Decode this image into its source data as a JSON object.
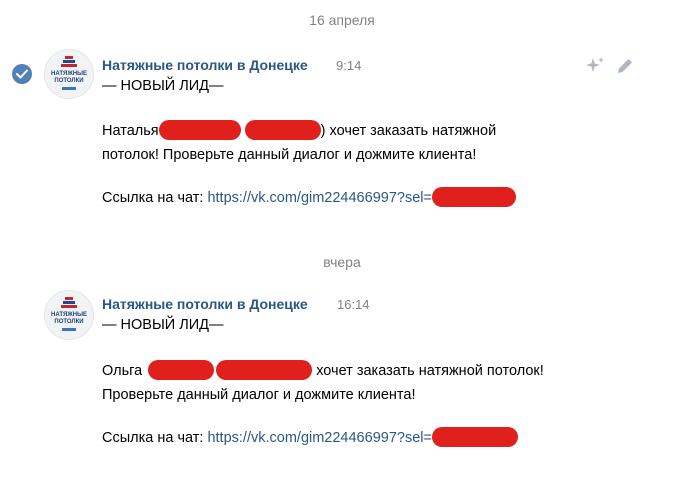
{
  "dates": {
    "first": "16 апреля",
    "second": "вчера"
  },
  "messages": [
    {
      "author": "Натяжные потолки в Донецке",
      "time": "9:14",
      "header": "— НОВЫЙ ЛИД—",
      "line1_name": "Наталья",
      "line1_close": ")",
      "line1_rest": " хочет заказать натяжной",
      "line2": "потолок! Проверьте данный диалог и дожмите клиента!",
      "link_label": "Ссылка на чат: ",
      "link_url": "https://vk.com/gim224466997?sel="
    },
    {
      "author": "Натяжные потолки в Донецке",
      "time": "16:14",
      "header": "— НОВЫЙ ЛИД—",
      "line1_name": "Ольга",
      "line1_close": "",
      "line1_rest": " хочет заказать натяжной потолок!",
      "line2": "Проверьте данный диалог и дожмите клиента!",
      "link_label": "Ссылка на чат: ",
      "link_url": "https://vk.com/gim224466997?sel="
    }
  ],
  "avatar_text": "НАТЯЖНЫЕ ПОТОЛКИ",
  "icons": [
    "check-icon",
    "sparkle-icon",
    "pencil-icon"
  ],
  "colors": {
    "accent": "#2a5885",
    "check_bg": "#5181b8",
    "redaction": "#e0201c",
    "muted": "#828282"
  }
}
